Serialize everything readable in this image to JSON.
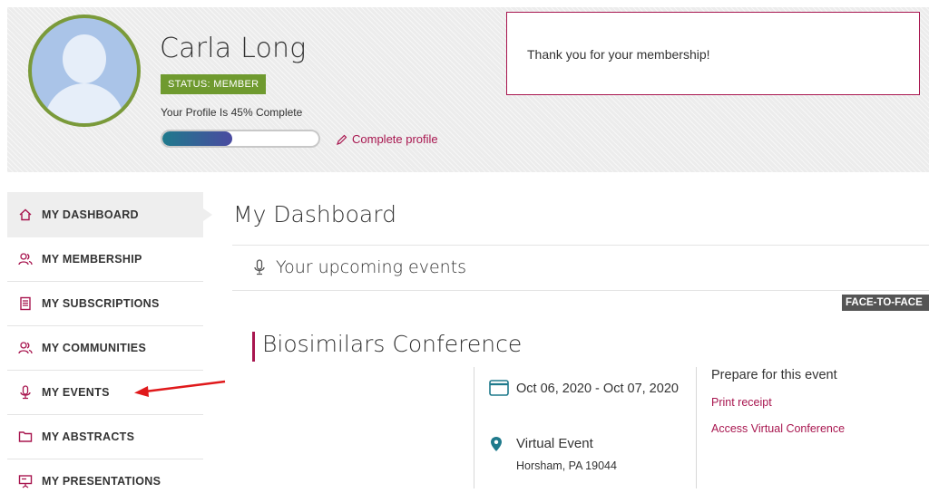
{
  "profile": {
    "name": "Carla Long",
    "status": "STATUS: MEMBER",
    "completion_text": "Your Profile Is 45% Complete",
    "completion_fraction": 0.45,
    "complete_link": "Complete profile",
    "avatar_icon": "person-silhouette-icon"
  },
  "notice": {
    "message": "Thank you for your membership!"
  },
  "sidebar": {
    "items": [
      {
        "label": "MY DASHBOARD",
        "icon": "home-icon",
        "active": true
      },
      {
        "label": "MY MEMBERSHIP",
        "icon": "users-icon",
        "active": false
      },
      {
        "label": "MY SUBSCRIPTIONS",
        "icon": "document-icon",
        "active": false
      },
      {
        "label": "MY COMMUNITIES",
        "icon": "users-icon",
        "active": false
      },
      {
        "label": "MY EVENTS",
        "icon": "microphone-icon",
        "active": false
      },
      {
        "label": "MY ABSTRACTS",
        "icon": "folder-icon",
        "active": false
      },
      {
        "label": "MY PRESENTATIONS",
        "icon": "presentation-icon",
        "active": false
      }
    ]
  },
  "main": {
    "title": "My Dashboard",
    "section_label": "Your upcoming events",
    "section_icon": "microphone-icon",
    "event": {
      "type_badge": "FACE-TO-FACE",
      "title": "Biosimilars Conference",
      "dates": "Oct 06, 2020 - Oct 07, 2020",
      "venue": "Virtual Event",
      "address": "Horsham, PA 19044",
      "prepare_heading": "Prepare for this event",
      "links": [
        "Print receipt",
        "Access Virtual Conference"
      ]
    }
  },
  "colors": {
    "accent": "#a8164f",
    "status_green": "#6f9a2f",
    "teal": "#1f7a8c",
    "annotation_arrow": "#e0191b"
  }
}
